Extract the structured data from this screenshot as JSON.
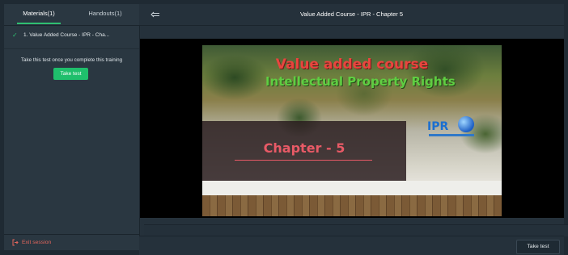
{
  "sidebar": {
    "tabs": [
      {
        "label": "Materials(1)",
        "active": true
      },
      {
        "label": "Handouts(1)",
        "active": false
      }
    ],
    "items": [
      {
        "label": "1. Value Added Course - IPR - Cha...",
        "completed": true
      }
    ],
    "test_prompt": "Take this test once you complete this training",
    "take_test_label": "Take test",
    "exit_label": "Exit session"
  },
  "header": {
    "title": "Value Added Course - IPR - Chapter 5"
  },
  "slide": {
    "title_line1": "Value added course",
    "title_line2": "Intellectual Property Rights",
    "logo_text": "IPR",
    "chapter": "Chapter - 5"
  },
  "footer": {
    "take_test_label": "Take test"
  },
  "colors": {
    "accent": "#1fbf6c",
    "exit": "#e0655c",
    "background": "#25313b"
  }
}
